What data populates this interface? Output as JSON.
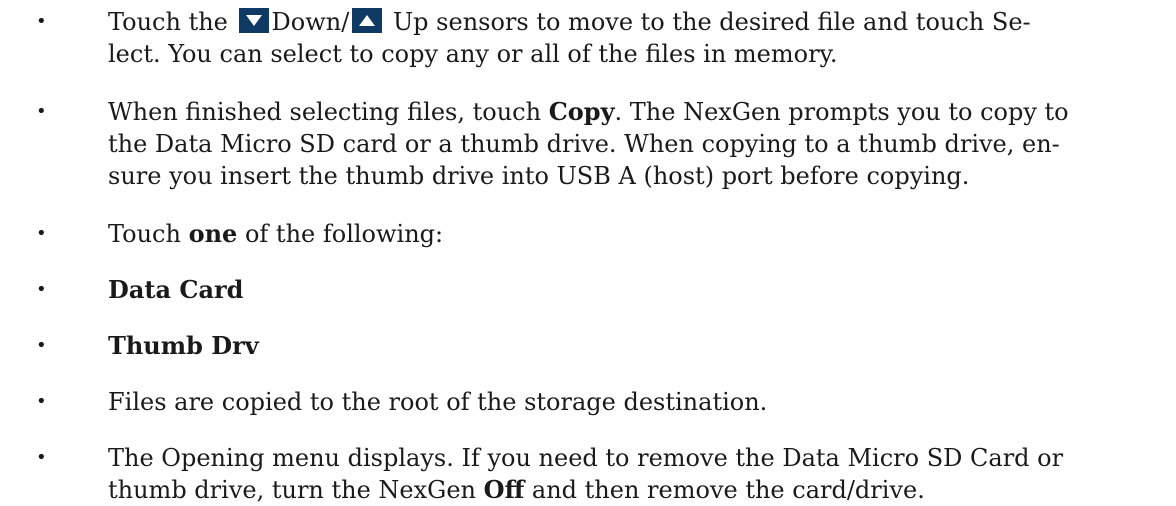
{
  "icons": {
    "down_arrow": "triangle-down-icon",
    "up_arrow": "triangle-up-icon",
    "button_bg": "#0e3a64",
    "arrow_fill": "#ffffff"
  },
  "items": [
    {
      "l1_a": "Touch the",
      "l1_b": "Down/",
      "l1_c": "Up sensors to move to the desired file and touch Se-",
      "l2": "lect. You can select to copy any or all of the files in memory."
    },
    {
      "l1_a": "When finished selecting files, touch",
      "l1_bold": "Copy",
      "l1_c": ". The NexGen prompts you to copy to",
      "l2": "the Data Micro SD card or a thumb drive. When copying to a thumb drive, en-",
      "l3": "sure you insert the thumb drive into USB A (host) port before copying."
    },
    {
      "a": "Touch",
      "bold": "one",
      "c": "of the following:"
    },
    {
      "bold": "Data Card"
    },
    {
      "bold": "Thumb Drv"
    },
    {
      "text": "Files are copied to the root of the storage destination."
    },
    {
      "l1": "The Opening menu displays. If you need to remove the Data Micro SD Card or",
      "l2_a": "thumb drive, turn the NexGen",
      "l2_bold": "Off",
      "l2_c": "and then remove the card/drive."
    }
  ],
  "bullet_char": "•"
}
